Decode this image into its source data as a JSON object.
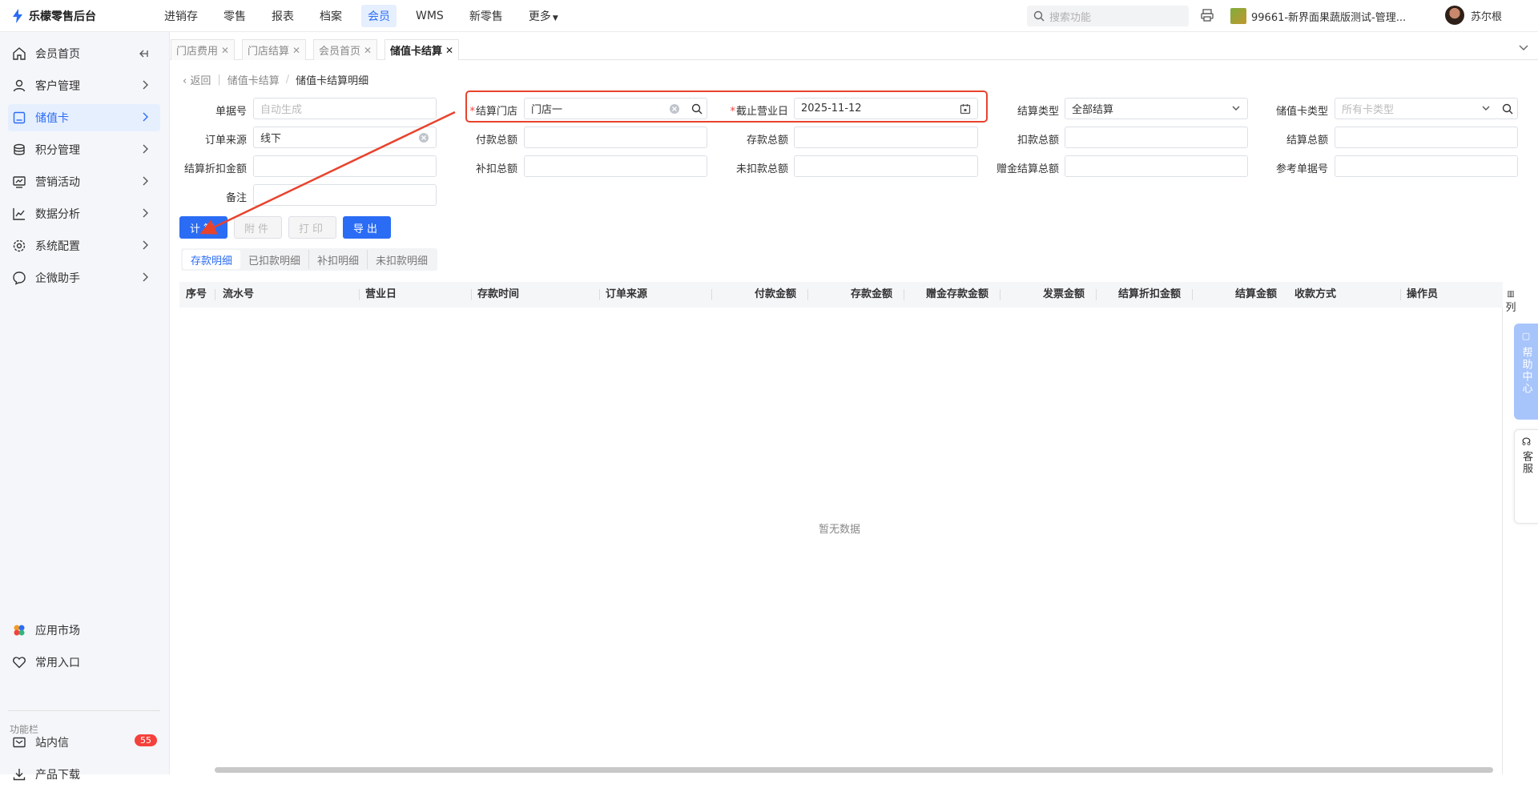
{
  "app": {
    "title": "乐檬零售后台"
  },
  "topnav": {
    "items": [
      "进销存",
      "零售",
      "报表",
      "档案",
      "会员",
      "WMS",
      "新零售",
      "更多"
    ],
    "active_index": 4,
    "search_placeholder": "搜索功能",
    "store_name": "99661-新界面果蔬版测试-管理...",
    "user_name": "苏尔根"
  },
  "sidebar": {
    "items": [
      {
        "label": "会员首页",
        "icon": "home-icon"
      },
      {
        "label": "客户管理",
        "icon": "user-icon"
      },
      {
        "label": "储值卡",
        "icon": "card-icon"
      },
      {
        "label": "积分管理",
        "icon": "coin-icon"
      },
      {
        "label": "营销活动",
        "icon": "campaign-icon"
      },
      {
        "label": "数据分析",
        "icon": "chart-icon"
      },
      {
        "label": "系统配置",
        "icon": "gear-icon"
      },
      {
        "label": "企微助手",
        "icon": "chat-icon"
      }
    ],
    "active_index": 2,
    "bottom_items": [
      {
        "label": "应用市场",
        "icon": "app-market-icon"
      },
      {
        "label": "常用入口",
        "icon": "heart-icon"
      }
    ],
    "section_label": "功能栏",
    "footer_items": [
      {
        "label": "站内信",
        "icon": "mail-icon",
        "badge": "55"
      },
      {
        "label": "产品下载",
        "icon": "download-icon"
      }
    ],
    "accent_color": "#2b6cf5"
  },
  "tabs": [
    {
      "label": "门店费用"
    },
    {
      "label": "门店结算"
    },
    {
      "label": "会员首页"
    },
    {
      "label": "储值卡结算",
      "active": true
    }
  ],
  "breadcrumb": {
    "back": "返回",
    "parent": "储值卡结算",
    "current": "储值卡结算明细"
  },
  "form": {
    "doc_no": {
      "label": "单据号",
      "placeholder": "自动生成"
    },
    "store": {
      "label": "结算门店",
      "value": "门店一",
      "required": true
    },
    "cutoff_date": {
      "label": "截止营业日",
      "value": "2025-11-12",
      "required": true
    },
    "settle_type": {
      "label": "结算类型",
      "value": "全部结算"
    },
    "card_type": {
      "label": "储值卡类型",
      "placeholder": "所有卡类型"
    },
    "order_source": {
      "label": "订单来源",
      "value": "线下"
    },
    "pay_total": {
      "label": "付款总额",
      "value": ""
    },
    "deposit_total": {
      "label": "存款总额",
      "value": ""
    },
    "deduct_total": {
      "label": "扣款总额",
      "value": ""
    },
    "settle_total": {
      "label": "结算总额",
      "value": ""
    },
    "settle_discount": {
      "label": "结算折扣金额",
      "value": ""
    },
    "supplement_total": {
      "label": "补扣总额",
      "value": ""
    },
    "undeducted_total": {
      "label": "未扣款总额",
      "value": ""
    },
    "bonus_settle_total": {
      "label": "赠金结算总额",
      "value": ""
    },
    "ref_no": {
      "label": "参考单据号",
      "value": ""
    },
    "remark": {
      "label": "备注",
      "value": ""
    }
  },
  "actions": {
    "calculate": "计算",
    "attachment": "附件",
    "print": "打印",
    "export": "导出"
  },
  "subtabs": [
    "存款明细",
    "已扣款明细",
    "补扣明细",
    "未扣款明细"
  ],
  "table": {
    "columns": [
      "序号",
      "流水号",
      "营业日",
      "存款时间",
      "订单来源",
      "付款金额",
      "存款金额",
      "赠金存款金额",
      "发票金额",
      "结算折扣金额",
      "结算金额",
      "收款方式",
      "操作员"
    ],
    "empty_text": "暂无数据",
    "column_tool": "列"
  },
  "float_panels": {
    "help": "帮助中心",
    "service": "客服"
  }
}
